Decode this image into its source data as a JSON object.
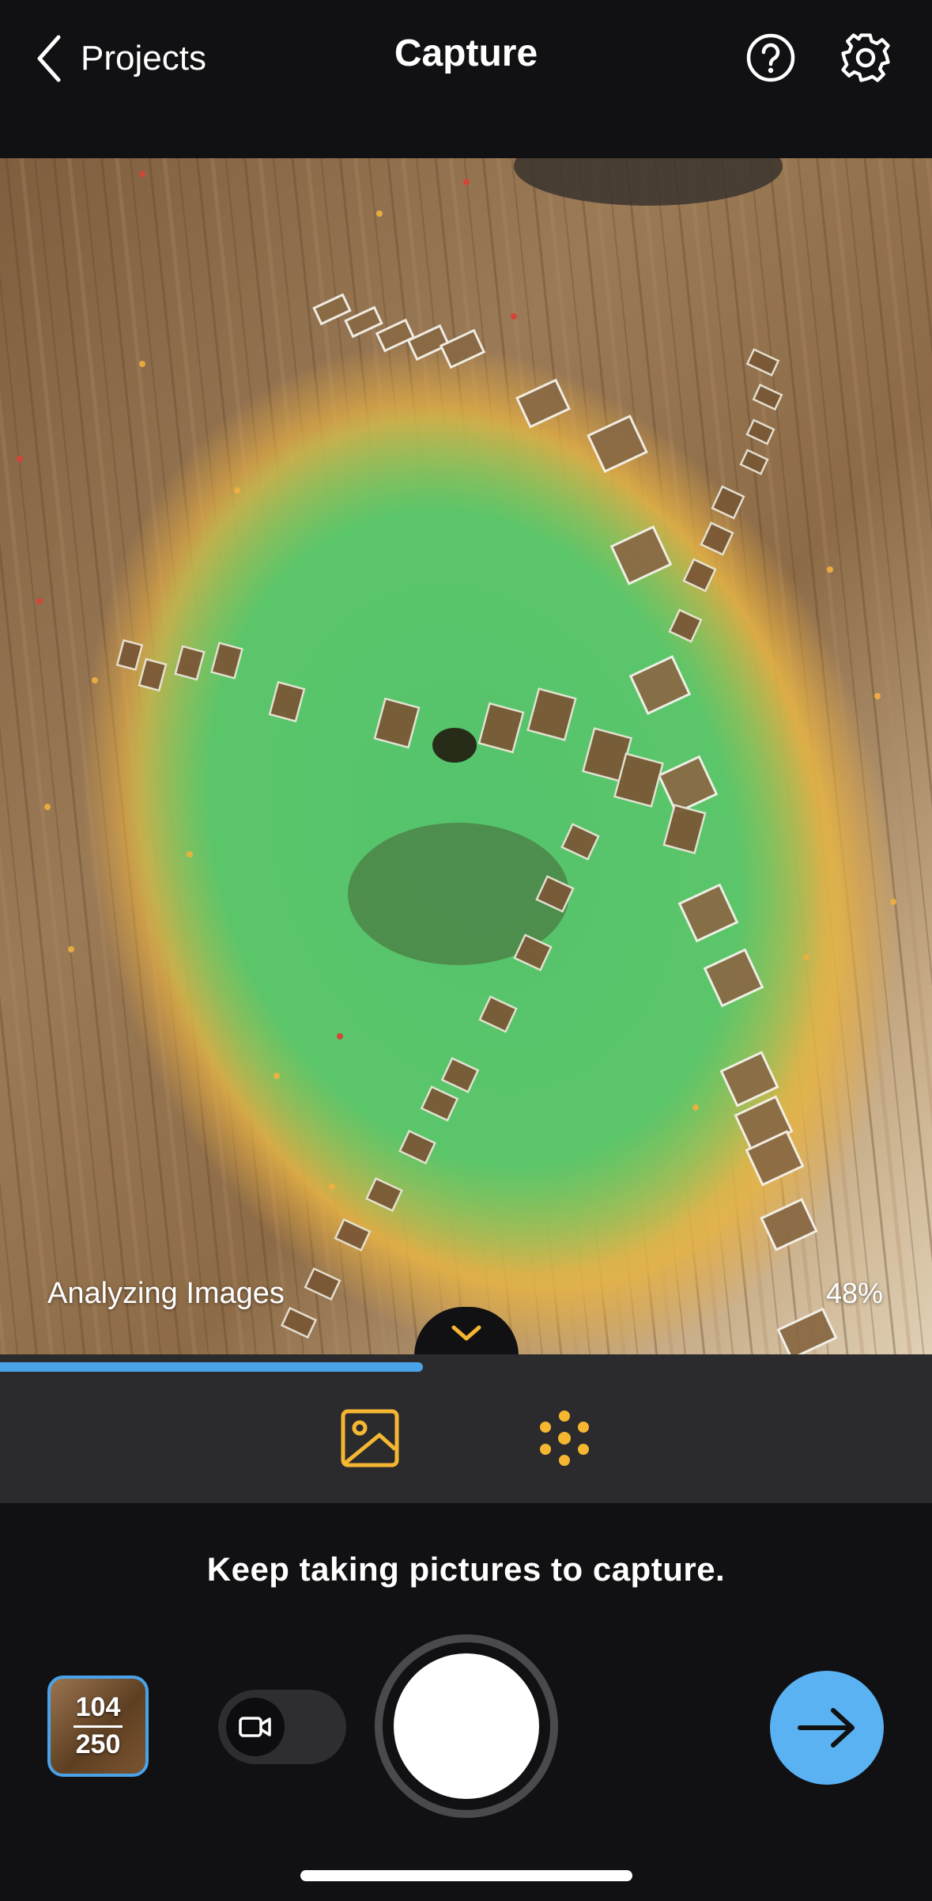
{
  "header": {
    "back_label": "Projects",
    "title": "Capture"
  },
  "viewport": {
    "status_label": "Analyzing Images",
    "progress_text": "48%",
    "progress_fraction": 0.48
  },
  "mode_bar": {
    "items": [
      {
        "icon": "image-icon",
        "color": "#f5b731"
      },
      {
        "icon": "point-cloud-icon",
        "color": "#f5b731"
      }
    ]
  },
  "capture": {
    "hint": "Keep taking pictures to capture.",
    "photo_count": "104",
    "photo_limit": "250"
  },
  "colors": {
    "accent_blue": "#4aa3e8",
    "button_blue": "#5ab2f2",
    "mode_yellow": "#f5b731"
  }
}
